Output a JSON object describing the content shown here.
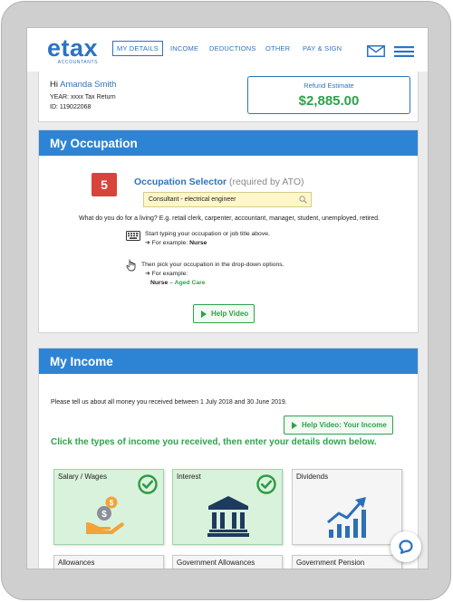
{
  "brand": {
    "logo": "etax",
    "sub": "ACCOUNTANTS",
    "primary": "#2c73c2",
    "header_blue": "#2e84d4",
    "green": "#2fa24a",
    "badge_red": "#d9443a"
  },
  "nav": {
    "items": [
      {
        "label": "MY DETAILS",
        "active": true
      },
      {
        "label": "INCOME"
      },
      {
        "label": "DEDUCTIONS"
      },
      {
        "label": "OTHER"
      },
      {
        "label": "PAY & SIGN"
      }
    ],
    "mail_icon": "envelope-icon",
    "menu_icon": "hamburger-menu-icon"
  },
  "user": {
    "greeting": "Hi",
    "name": "Amanda Smith",
    "year": "YEAR: xxxx Tax Return",
    "id": "ID: 119022068"
  },
  "refund": {
    "label": "Refund Estimate",
    "amount": "$2,885.00"
  },
  "occupation": {
    "heading": "My Occupation",
    "step": "5",
    "selector_title": "Occupation Selector",
    "selector_note": "(required by ATO)",
    "input_value": "Consultant - electrical engineer",
    "question": "What do you do for a living? E.g. retail clerk, carpenter, accountant, manager, student, unemployed, retired.",
    "tip1_line1": "Start typing your occupation or job title above.",
    "tip1_prefix": "➔ For example:",
    "tip1_example": "Nurse",
    "tip2_line1": "Then pick your occupation in the drop-down options.",
    "tip2_line2": "➔ For example:",
    "tip2_example_main": "Nurse",
    "tip2_example_sub": "– Aged Care",
    "help_video": "Help Video"
  },
  "income": {
    "heading": "My Income",
    "intro": "Please tell us about all money you received between 1 July 2018 and 30 June 2019.",
    "help_video": "Help Video: Your Income",
    "instruction": "Click the types of income you received, then enter your details down below.",
    "tiles": [
      {
        "label": "Salary / Wages",
        "selected": true,
        "icon": "hand-coins-icon"
      },
      {
        "label": "Interest",
        "selected": true,
        "icon": "bank-icon"
      },
      {
        "label": "Dividends",
        "selected": false,
        "icon": "rising-chart-icon"
      },
      {
        "label": "Allowances",
        "selected": false
      },
      {
        "label": "Government Allowances",
        "selected": false
      },
      {
        "label": "Government Pension",
        "selected": false
      }
    ]
  },
  "chat": {
    "icon": "chat-bubble-icon"
  }
}
